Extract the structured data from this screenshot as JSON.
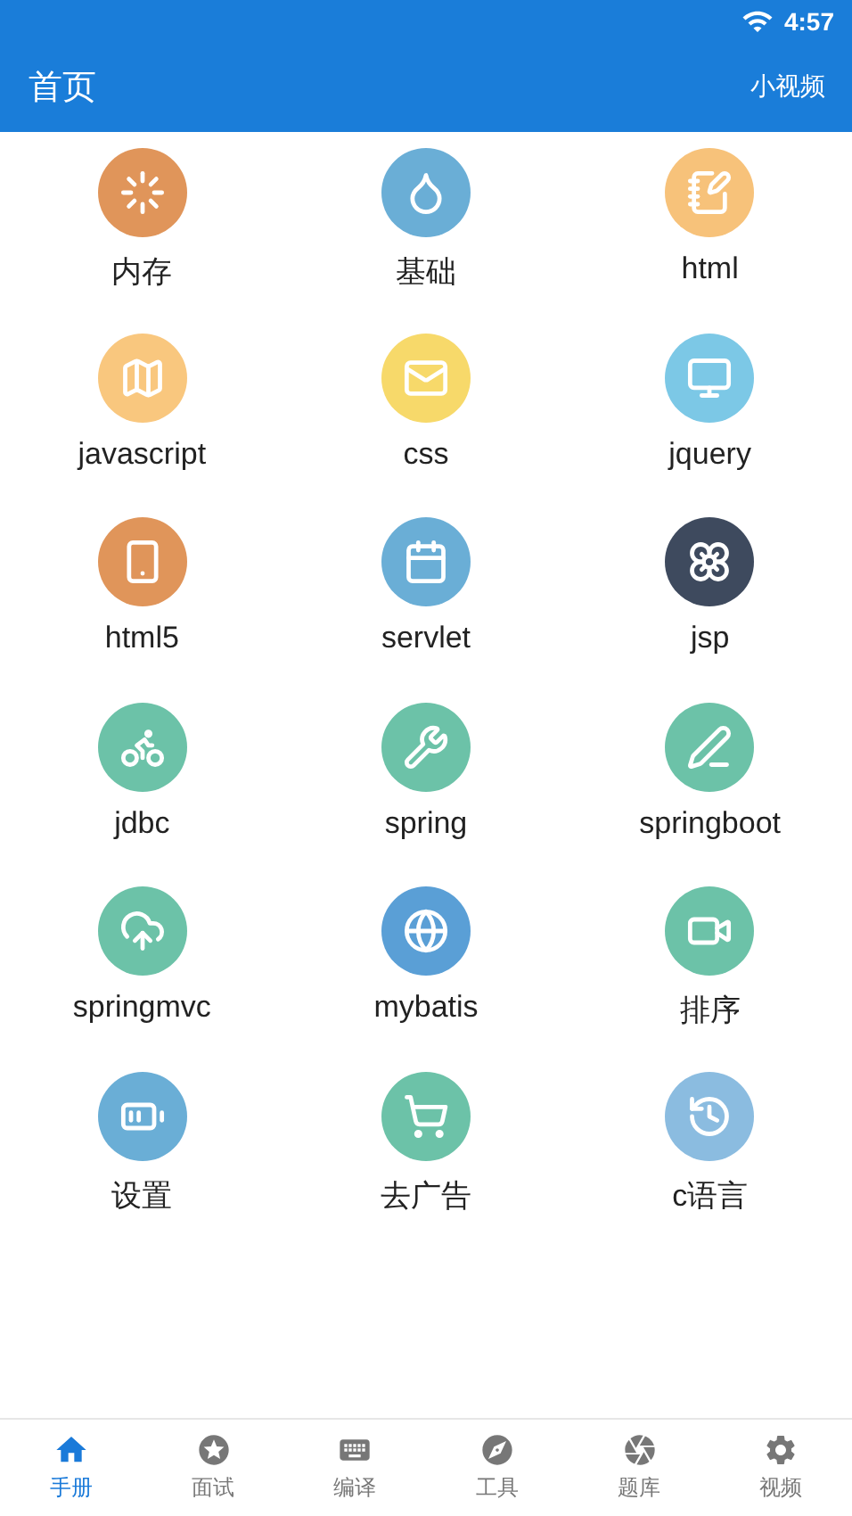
{
  "status_bar": {
    "time": "4:57"
  },
  "app_bar": {
    "title": "首页",
    "action": "小视频"
  },
  "grid_items": [
    {
      "label": "内存",
      "kind": "loader",
      "color": "#e0955a"
    },
    {
      "label": "基础",
      "kind": "droplet",
      "color": "#6aaed6"
    },
    {
      "label": "html",
      "kind": "notepad",
      "color": "#f7c27a"
    },
    {
      "label": "javascript",
      "kind": "map",
      "color": "#f9c77e"
    },
    {
      "label": "css",
      "kind": "mail",
      "color": "#f7d96a"
    },
    {
      "label": "jquery",
      "kind": "monitor",
      "color": "#7cc8e6"
    },
    {
      "label": "html5",
      "kind": "phone",
      "color": "#e0955a"
    },
    {
      "label": "servlet",
      "kind": "calendar",
      "color": "#6aaed6"
    },
    {
      "label": "jsp",
      "kind": "flower",
      "color": "#3e4a5e"
    },
    {
      "label": "jdbc",
      "kind": "bike",
      "color": "#6cc2a8"
    },
    {
      "label": "spring",
      "kind": "wrench",
      "color": "#6cc2a8"
    },
    {
      "label": "springboot",
      "kind": "pencil",
      "color": "#6cc2a8"
    },
    {
      "label": "springmvc",
      "kind": "cloud",
      "color": "#6cc2a8"
    },
    {
      "label": "mybatis",
      "kind": "globe",
      "color": "#5a9fd6"
    },
    {
      "label": "排序",
      "kind": "video",
      "color": "#6cc2a8"
    },
    {
      "label": "设置",
      "kind": "battery",
      "color": "#6aaed6"
    },
    {
      "label": "去广告",
      "kind": "cart",
      "color": "#6cc2a8"
    },
    {
      "label": "c语言",
      "kind": "clock",
      "color": "#8bbce0"
    }
  ],
  "bottom_tabs": [
    {
      "label": "手册",
      "kind": "home",
      "selected": true
    },
    {
      "label": "面试",
      "kind": "star",
      "selected": false
    },
    {
      "label": "编译",
      "kind": "keyboard",
      "selected": false
    },
    {
      "label": "工具",
      "kind": "compass",
      "selected": false
    },
    {
      "label": "题库",
      "kind": "aperture",
      "selected": false
    },
    {
      "label": "视频",
      "kind": "settings",
      "selected": false
    }
  ]
}
